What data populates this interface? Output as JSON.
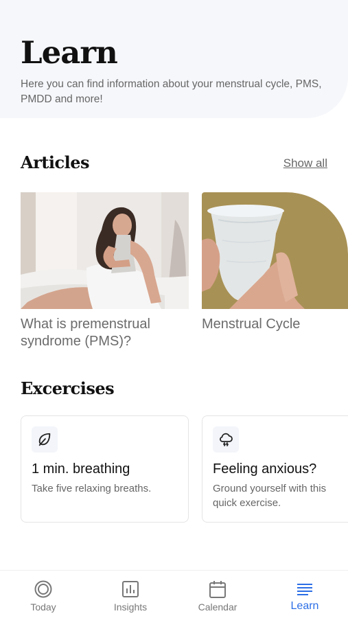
{
  "header": {
    "title": "Learn",
    "subtitle": "Here you can find information about your menstrual cycle, PMS, PMDD and more!"
  },
  "articles": {
    "section_title": "Articles",
    "show_all_label": "Show all",
    "items": [
      {
        "title": "What is premenstrual syndrome (PMS)?"
      },
      {
        "title": "Menstrual Cycle"
      }
    ]
  },
  "exercises": {
    "section_title": "Excercises",
    "items": [
      {
        "icon": "leaf-icon",
        "title": "1 min. breathing",
        "description": "Take five relaxing breaths."
      },
      {
        "icon": "storm-cloud-icon",
        "title": "Feeling anxious?",
        "description": "Ground yourself with this quick exercise."
      }
    ]
  },
  "tabbar": {
    "tabs": [
      {
        "icon": "today-icon",
        "label": "Today"
      },
      {
        "icon": "insights-icon",
        "label": "Insights"
      },
      {
        "icon": "calendar-icon",
        "label": "Calendar"
      },
      {
        "icon": "learn-icon",
        "label": "Learn"
      }
    ],
    "active_tab": "Learn",
    "active_color": "#2b6ee6"
  }
}
